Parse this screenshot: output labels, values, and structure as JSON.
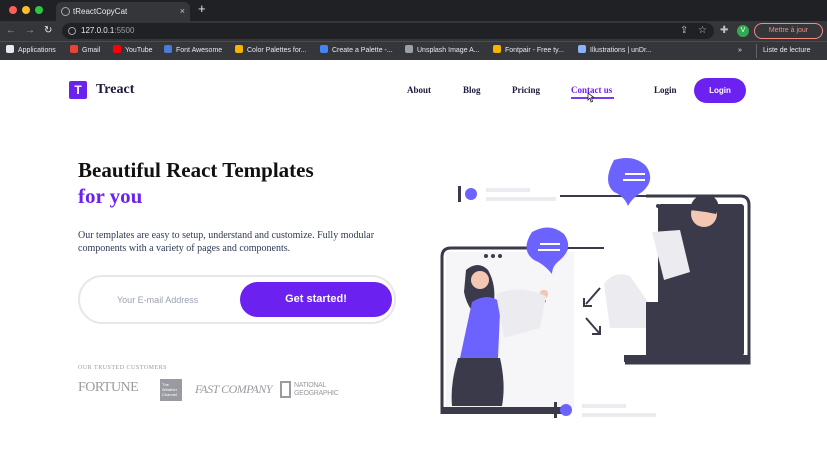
{
  "browser": {
    "tab_title": "tReactCopyCat",
    "url_host": "127.0.0.1",
    "url_port": ":5500",
    "profile_initial": "V",
    "update_label": "Mettre à jour",
    "bookmarks": [
      "Applications",
      "Gmail",
      "YouTube",
      "Font Awesome",
      "Color Palettes for...",
      "Create a Palette -...",
      "Unsplash Image A...",
      "Fontpair - Free ty...",
      "Illustrations | unDr..."
    ],
    "bookmark_colors": [
      "#e8eaed",
      "#ea4335",
      "#ff0000",
      "#4a7bd6",
      "#f4b400",
      "#4285f4",
      "#9aa0a6",
      "#f4b400",
      "#8ab4f8"
    ],
    "reading_list": "Liste de lecture",
    "more": "»"
  },
  "header": {
    "logo_letter": "T",
    "brand": "Treact",
    "nav": [
      "About",
      "Blog",
      "Pricing",
      "Contact us",
      "Login"
    ],
    "cta": "Login"
  },
  "hero": {
    "title_line1": "Beautiful React Templates",
    "title_line2": "for you",
    "description": "Our templates are easy to setup, understand and customize. Fully modular components with a variety of pages and components.",
    "email_placeholder": "Your E-mail Address",
    "button": "Get started!"
  },
  "customers": {
    "heading": "OUR TRUSTED CUSTOMERS",
    "logos": [
      "FORTUNE",
      "The Weather Channel",
      "FAST COMPANY",
      "NATIONAL GEOGRAPHIC"
    ]
  },
  "colors": {
    "accent": "#6b21f0",
    "illustration_dark": "#3a3a4a",
    "illustration_purple": "#6c63ff"
  }
}
